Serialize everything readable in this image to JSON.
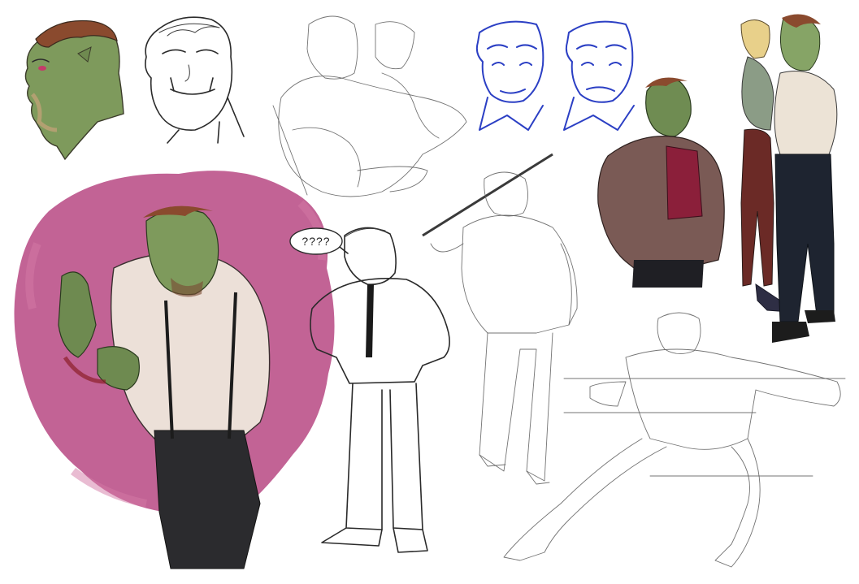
{
  "sheet": {
    "speech_bubble_text": "????"
  },
  "colors": {
    "background": "#ffffff",
    "splash_magenta": "#b94d86",
    "orc_skin": "#7e9a5c",
    "hair": "#8a4a2e",
    "blue_ink": "#2b3fc4",
    "jacket_brown": "#7a5a55",
    "vest_red": "#8b1f3a"
  }
}
